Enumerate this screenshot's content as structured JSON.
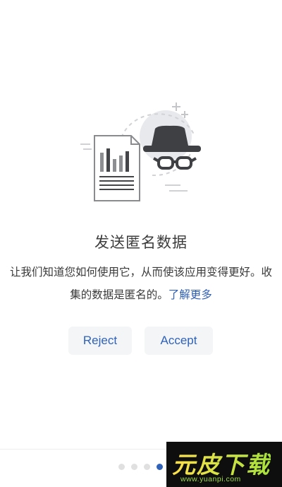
{
  "screen": {
    "title": "发送匿名数据",
    "description": "让我们知道您如何使用它，从而使该应用变得更好。收集的数据是匿名的。",
    "learn_more_link": "了解更多"
  },
  "buttons": {
    "reject_label": "Reject",
    "accept_label": "Accept"
  },
  "pager": {
    "total_pages": 4,
    "current_page": 4
  },
  "illustration": {
    "icons": [
      "document-chart-icon",
      "incognito-hat-glasses-icon",
      "sparkle-plus-icon"
    ]
  },
  "watermark": {
    "brand": "元皮下载",
    "url": "www.yuanpi.com"
  },
  "colors": {
    "accent": "#2f62b8",
    "link": "#2f5fb3",
    "button_bg": "#f4f5f7",
    "dot_inactive": "#e0e0e0"
  }
}
